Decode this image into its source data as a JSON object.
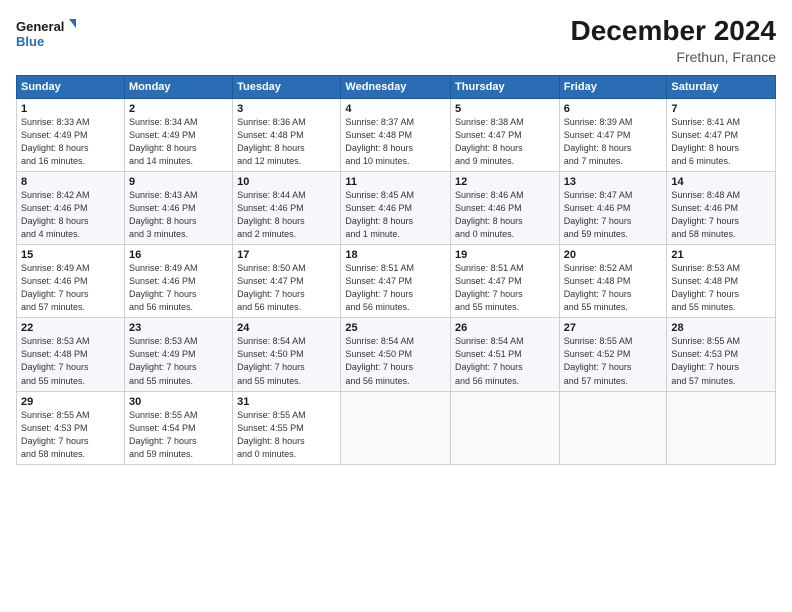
{
  "header": {
    "logo_line1": "General",
    "logo_line2": "Blue",
    "title": "December 2024",
    "subtitle": "Frethun, France"
  },
  "columns": [
    "Sunday",
    "Monday",
    "Tuesday",
    "Wednesday",
    "Thursday",
    "Friday",
    "Saturday"
  ],
  "weeks": [
    [
      {
        "day": "1",
        "info": "Sunrise: 8:33 AM\nSunset: 4:49 PM\nDaylight: 8 hours\nand 16 minutes."
      },
      {
        "day": "2",
        "info": "Sunrise: 8:34 AM\nSunset: 4:49 PM\nDaylight: 8 hours\nand 14 minutes."
      },
      {
        "day": "3",
        "info": "Sunrise: 8:36 AM\nSunset: 4:48 PM\nDaylight: 8 hours\nand 12 minutes."
      },
      {
        "day": "4",
        "info": "Sunrise: 8:37 AM\nSunset: 4:48 PM\nDaylight: 8 hours\nand 10 minutes."
      },
      {
        "day": "5",
        "info": "Sunrise: 8:38 AM\nSunset: 4:47 PM\nDaylight: 8 hours\nand 9 minutes."
      },
      {
        "day": "6",
        "info": "Sunrise: 8:39 AM\nSunset: 4:47 PM\nDaylight: 8 hours\nand 7 minutes."
      },
      {
        "day": "7",
        "info": "Sunrise: 8:41 AM\nSunset: 4:47 PM\nDaylight: 8 hours\nand 6 minutes."
      }
    ],
    [
      {
        "day": "8",
        "info": "Sunrise: 8:42 AM\nSunset: 4:46 PM\nDaylight: 8 hours\nand 4 minutes."
      },
      {
        "day": "9",
        "info": "Sunrise: 8:43 AM\nSunset: 4:46 PM\nDaylight: 8 hours\nand 3 minutes."
      },
      {
        "day": "10",
        "info": "Sunrise: 8:44 AM\nSunset: 4:46 PM\nDaylight: 8 hours\nand 2 minutes."
      },
      {
        "day": "11",
        "info": "Sunrise: 8:45 AM\nSunset: 4:46 PM\nDaylight: 8 hours\nand 1 minute."
      },
      {
        "day": "12",
        "info": "Sunrise: 8:46 AM\nSunset: 4:46 PM\nDaylight: 8 hours\nand 0 minutes."
      },
      {
        "day": "13",
        "info": "Sunrise: 8:47 AM\nSunset: 4:46 PM\nDaylight: 7 hours\nand 59 minutes."
      },
      {
        "day": "14",
        "info": "Sunrise: 8:48 AM\nSunset: 4:46 PM\nDaylight: 7 hours\nand 58 minutes."
      }
    ],
    [
      {
        "day": "15",
        "info": "Sunrise: 8:49 AM\nSunset: 4:46 PM\nDaylight: 7 hours\nand 57 minutes."
      },
      {
        "day": "16",
        "info": "Sunrise: 8:49 AM\nSunset: 4:46 PM\nDaylight: 7 hours\nand 56 minutes."
      },
      {
        "day": "17",
        "info": "Sunrise: 8:50 AM\nSunset: 4:47 PM\nDaylight: 7 hours\nand 56 minutes."
      },
      {
        "day": "18",
        "info": "Sunrise: 8:51 AM\nSunset: 4:47 PM\nDaylight: 7 hours\nand 56 minutes."
      },
      {
        "day": "19",
        "info": "Sunrise: 8:51 AM\nSunset: 4:47 PM\nDaylight: 7 hours\nand 55 minutes."
      },
      {
        "day": "20",
        "info": "Sunrise: 8:52 AM\nSunset: 4:48 PM\nDaylight: 7 hours\nand 55 minutes."
      },
      {
        "day": "21",
        "info": "Sunrise: 8:53 AM\nSunset: 4:48 PM\nDaylight: 7 hours\nand 55 minutes."
      }
    ],
    [
      {
        "day": "22",
        "info": "Sunrise: 8:53 AM\nSunset: 4:48 PM\nDaylight: 7 hours\nand 55 minutes."
      },
      {
        "day": "23",
        "info": "Sunrise: 8:53 AM\nSunset: 4:49 PM\nDaylight: 7 hours\nand 55 minutes."
      },
      {
        "day": "24",
        "info": "Sunrise: 8:54 AM\nSunset: 4:50 PM\nDaylight: 7 hours\nand 55 minutes."
      },
      {
        "day": "25",
        "info": "Sunrise: 8:54 AM\nSunset: 4:50 PM\nDaylight: 7 hours\nand 56 minutes."
      },
      {
        "day": "26",
        "info": "Sunrise: 8:54 AM\nSunset: 4:51 PM\nDaylight: 7 hours\nand 56 minutes."
      },
      {
        "day": "27",
        "info": "Sunrise: 8:55 AM\nSunset: 4:52 PM\nDaylight: 7 hours\nand 57 minutes."
      },
      {
        "day": "28",
        "info": "Sunrise: 8:55 AM\nSunset: 4:53 PM\nDaylight: 7 hours\nand 57 minutes."
      }
    ],
    [
      {
        "day": "29",
        "info": "Sunrise: 8:55 AM\nSunset: 4:53 PM\nDaylight: 7 hours\nand 58 minutes."
      },
      {
        "day": "30",
        "info": "Sunrise: 8:55 AM\nSunset: 4:54 PM\nDaylight: 7 hours\nand 59 minutes."
      },
      {
        "day": "31",
        "info": "Sunrise: 8:55 AM\nSunset: 4:55 PM\nDaylight: 8 hours\nand 0 minutes."
      },
      null,
      null,
      null,
      null
    ]
  ]
}
